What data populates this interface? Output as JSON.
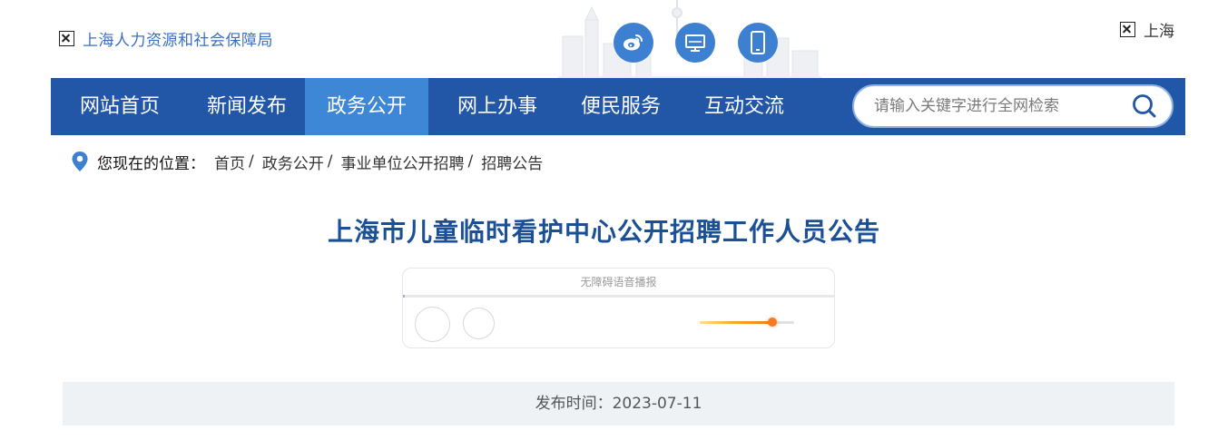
{
  "header": {
    "logo_text": "上海人力资源和社会保障局",
    "region_text": "上海",
    "social_icons": [
      "weibo-icon",
      "desktop-icon",
      "mobile-icon"
    ]
  },
  "nav": {
    "items": [
      {
        "label": "网站首页",
        "active": false
      },
      {
        "label": "新闻发布",
        "active": false
      },
      {
        "label": "政务公开",
        "active": true
      },
      {
        "label": "网上办事",
        "active": false
      },
      {
        "label": "便民服务",
        "active": false
      },
      {
        "label": "互动交流",
        "active": false
      }
    ],
    "search_placeholder": "请输入关键字进行全网检索"
  },
  "breadcrumb": {
    "label": "您现在的位置：",
    "items": [
      "首页",
      "政务公开",
      "事业单位公开招聘",
      "招聘公告"
    ],
    "separator": "/"
  },
  "article": {
    "title": "上海市儿童临时看护中心公开招聘工作人员公告",
    "publish_date": "发布时间：2023-07-11"
  },
  "player": {
    "title": "无障碍语音播报",
    "progress": 0,
    "volume": 0.77
  },
  "colors": {
    "nav_bg": "#2256a7",
    "nav_active": "#3e86d6",
    "title": "#1b4f96",
    "accent": "#3d7fd0",
    "volume": "#f47b20"
  }
}
